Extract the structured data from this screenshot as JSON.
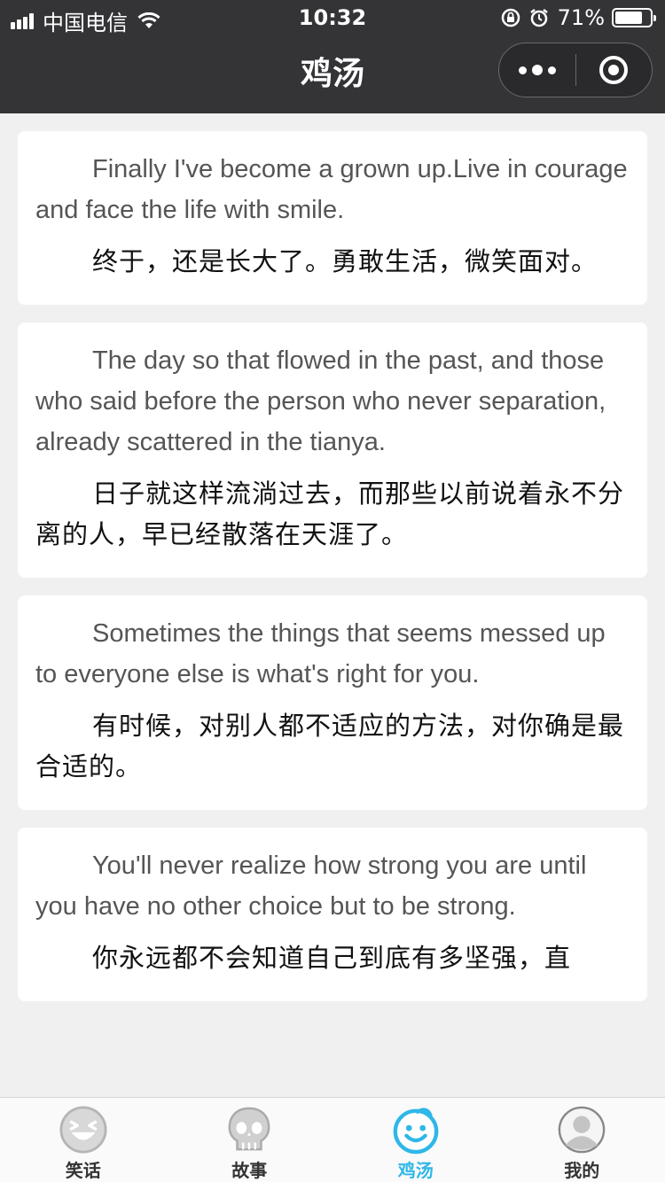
{
  "status_bar": {
    "carrier": "中国电信",
    "time": "10:32",
    "battery_percent": "71%",
    "battery_level": 0.71
  },
  "nav": {
    "title": "鸡汤"
  },
  "cards": [
    {
      "en": "Finally I've become a grown up.Live in courage and face the life with smile.",
      "zh": "终于，还是长大了。勇敢生活，微笑面对。"
    },
    {
      "en": "The day so that flowed in the past, and those who said before the person who never separation, already scattered in the tianya.",
      "zh": "日子就这样流淌过去，而那些以前说着永不分离的人，早已经散落在天涯了。"
    },
    {
      "en": "Sometimes the things that seems messed up to everyone else is what's right for you.",
      "zh": "有时候，对别人都不适应的方法，对你确是最合适的。"
    },
    {
      "en": "You'll never realize how strong you are until you have no other choice but to be strong.",
      "zh": "你永远都不会知道自己到底有多坚强，直"
    }
  ],
  "tabbar": {
    "tabs": [
      {
        "label": "笑话",
        "icon": "laugh-face-icon",
        "active": false
      },
      {
        "label": "故事",
        "icon": "skull-icon",
        "active": false
      },
      {
        "label": "鸡汤",
        "icon": "smile-face-icon",
        "active": true
      },
      {
        "label": "我的",
        "icon": "user-avatar-icon",
        "active": false
      }
    ],
    "active_color": "#2fb7e8"
  }
}
